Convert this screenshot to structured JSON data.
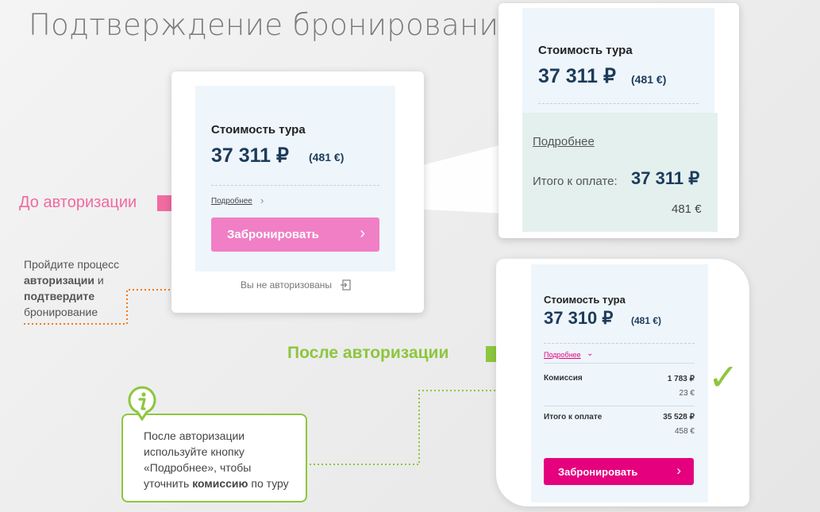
{
  "slide": {
    "title": "Подтверждение бронирования"
  },
  "before": {
    "label": "До авторизации",
    "card": {
      "cost_label": "Стоимость тура",
      "price": "37 311 ₽",
      "price_eur": "(481 €)",
      "details_link": "Подробнее",
      "book_button": "Забронировать",
      "not_authorized": "Вы не авторизованы"
    }
  },
  "zoom": {
    "cost_label": "Стоимость тура",
    "price": "37 311 ₽",
    "price_eur": "(481 €)",
    "details_link": "Подробнее",
    "total_label": "Итого к оплате:",
    "total_price": "37 311 ₽",
    "total_eur": "481 €"
  },
  "note_auth": {
    "line1": "Пройдите процесс",
    "line2_bold": "авторизации",
    "line2_rest": " и",
    "line3_bold": "подтвердите",
    "line4": "бронирование"
  },
  "after": {
    "label": "После авторизации",
    "card": {
      "cost_label": "Стоимость тура",
      "price": "37 310 ₽",
      "price_eur": "(481 €)",
      "details_link": "Подробнее",
      "commission_label": "Комиссия",
      "commission_rub": "1 783 ₽",
      "commission_eur": "23 €",
      "total_label": "Итого к оплате",
      "total_rub": "35 528 ₽",
      "total_eur": "458 €",
      "book_button": "Забронировать"
    }
  },
  "tip": {
    "icon_letter": "i",
    "line1": "После авторизации",
    "line2": "используйте кнопку",
    "line3": "«Подробнее», чтобы",
    "line4_pre": "уточнить ",
    "line4_bold": "комиссию",
    "line4_post": " по туру"
  },
  "colors": {
    "pink_arrow": "#f06ba0",
    "green_arrow": "#8dc63f",
    "book_before": "#f07fc5",
    "book_after": "#e5007e",
    "price_blue": "#1d3b5a",
    "dotted_orange": "#f07a1a"
  },
  "icons": {
    "checkmark": "✓",
    "login": "sign-in-icon",
    "chevron": "›"
  }
}
